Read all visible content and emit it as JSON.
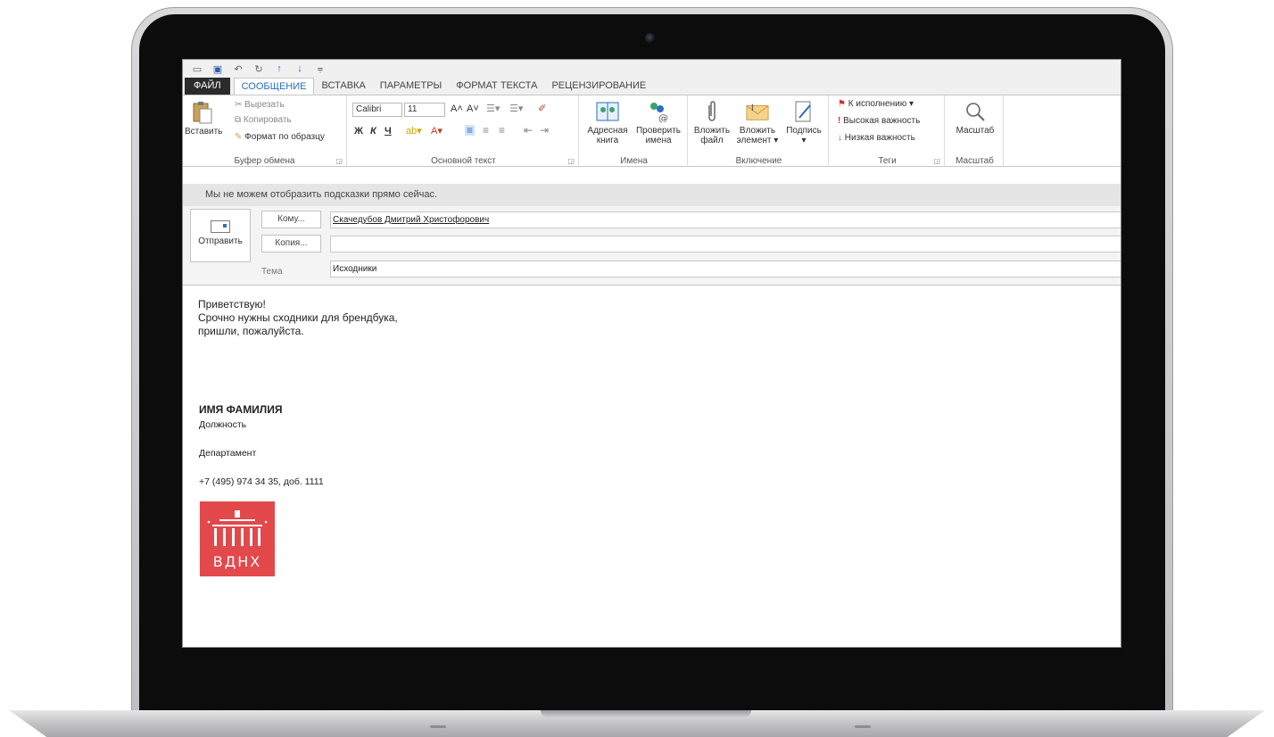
{
  "quick_access": {
    "icons": [
      "window-icon",
      "save-icon",
      "undo-icon",
      "redo-icon",
      "up-arrow-icon",
      "down-arrow-icon",
      "customize-icon"
    ]
  },
  "tabs": [
    {
      "label": "ФАЙЛ"
    },
    {
      "label": "СООБЩЕНИЕ"
    },
    {
      "label": "ВСТАВКА"
    },
    {
      "label": "ПАРАМЕТРЫ"
    },
    {
      "label": "ФОРМАТ ТЕКСТА"
    },
    {
      "label": "РЕЦЕНЗИРОВАНИЕ"
    }
  ],
  "ribbon": {
    "clipboard": {
      "paste": "Вставить",
      "cut": "Вырезать",
      "copy": "Копировать",
      "format_painter": "Формат по образцу",
      "label": "Буфер обмена"
    },
    "basic_text": {
      "font": "Calibri",
      "size": "11",
      "bold": "Ж",
      "italic": "К",
      "underline": "Ч",
      "label": "Основной текст"
    },
    "names": {
      "address_book_1": "Адресная",
      "address_book_2": "книга",
      "check_names_1": "Проверить",
      "check_names_2": "имена",
      "label": "Имена"
    },
    "include": {
      "attach_file_1": "Вложить",
      "attach_file_2": "файл",
      "attach_item_1": "Вложить",
      "attach_item_2": "элемент",
      "signature": "Подпись",
      "label": "Включение"
    },
    "tags": {
      "follow_up": "К исполнению",
      "high_importance": "Высокая важность",
      "low_importance": "Низкая важность",
      "label": "Теги"
    },
    "zoom": {
      "button": "Масштаб",
      "label": "Масштаб"
    }
  },
  "infobar": {
    "text": "Мы не можем отобразить подсказки прямо сейчас."
  },
  "compose": {
    "send": "Отправить",
    "to_button": "Кому...",
    "to_value": "Скачедубов Дмитрий Христофорович",
    "cc_button": "Копия...",
    "cc_value": "",
    "subject_label": "Тема",
    "subject_value": "Исходники"
  },
  "body": {
    "lines": [
      "Приветствую!",
      "Срочно нужны сходники для брендбука,",
      "пришли, пожалуйста."
    ],
    "signature": {
      "name": "ИМЯ ФАМИЛИЯ",
      "position": "Должность",
      "department": "Департамент",
      "phone": "+7 (495) 974 34 35, доб. 1111",
      "logo_text": "ВДНХ",
      "logo_color": "#e3484b"
    }
  }
}
